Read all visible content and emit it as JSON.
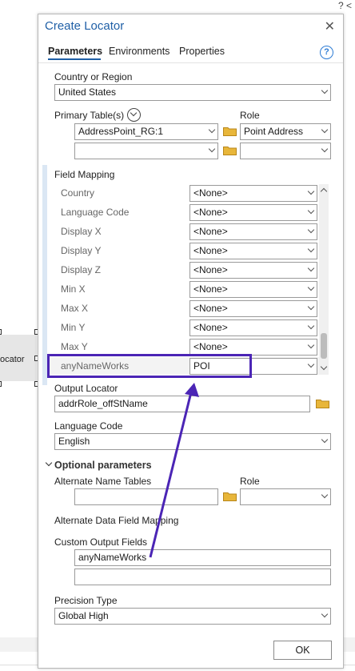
{
  "background": {
    "corner_text": "? <",
    "node_label": "ocator"
  },
  "pane": {
    "title": "Create Locator",
    "tabs": [
      "Parameters",
      "Environments",
      "Properties"
    ],
    "country": {
      "label": "Country or Region",
      "value": "United States"
    },
    "primary_tables": {
      "label": "Primary Table(s)",
      "role_label": "Role",
      "rows": [
        {
          "table": "AddressPoint_RG:1",
          "role": "Point Address"
        },
        {
          "table": "",
          "role": ""
        }
      ]
    },
    "field_mapping": {
      "label": "Field Mapping",
      "rows": [
        {
          "name": "Country",
          "value": "<None>"
        },
        {
          "name": "Language Code",
          "value": "<None>"
        },
        {
          "name": "Display X",
          "value": "<None>"
        },
        {
          "name": "Display Y",
          "value": "<None>"
        },
        {
          "name": "Display Z",
          "value": "<None>"
        },
        {
          "name": "Min X",
          "value": "<None>"
        },
        {
          "name": "Max X",
          "value": "<None>"
        },
        {
          "name": "Min Y",
          "value": "<None>"
        },
        {
          "name": "Max Y",
          "value": "<None>"
        },
        {
          "name": "anyNameWorks",
          "value": "POI"
        }
      ]
    },
    "output_locator": {
      "label": "Output Locator",
      "value": "addrRole_offStName"
    },
    "language_code": {
      "label": "Language Code",
      "value": "English"
    },
    "optional": {
      "heading": "Optional parameters",
      "alternate_name_tables": {
        "label": "Alternate Name Tables",
        "role_label": "Role",
        "table_value": "",
        "role_value": ""
      },
      "alternate_data_field_mapping": "Alternate Data Field Mapping",
      "custom_output_fields": {
        "label": "Custom Output Fields",
        "values": [
          "anyNameWorks",
          ""
        ]
      }
    },
    "precision_type": {
      "label": "Precision Type",
      "value": "Global High"
    },
    "ok_label": "OK"
  },
  "colors": {
    "accent": "#1f5fa6",
    "highlight": "#4b25b5",
    "folder": "#e8b63a"
  },
  "icons": [
    "close-icon",
    "help-icon",
    "collapse-icon",
    "folder-icon",
    "chevron-down-icon"
  ]
}
